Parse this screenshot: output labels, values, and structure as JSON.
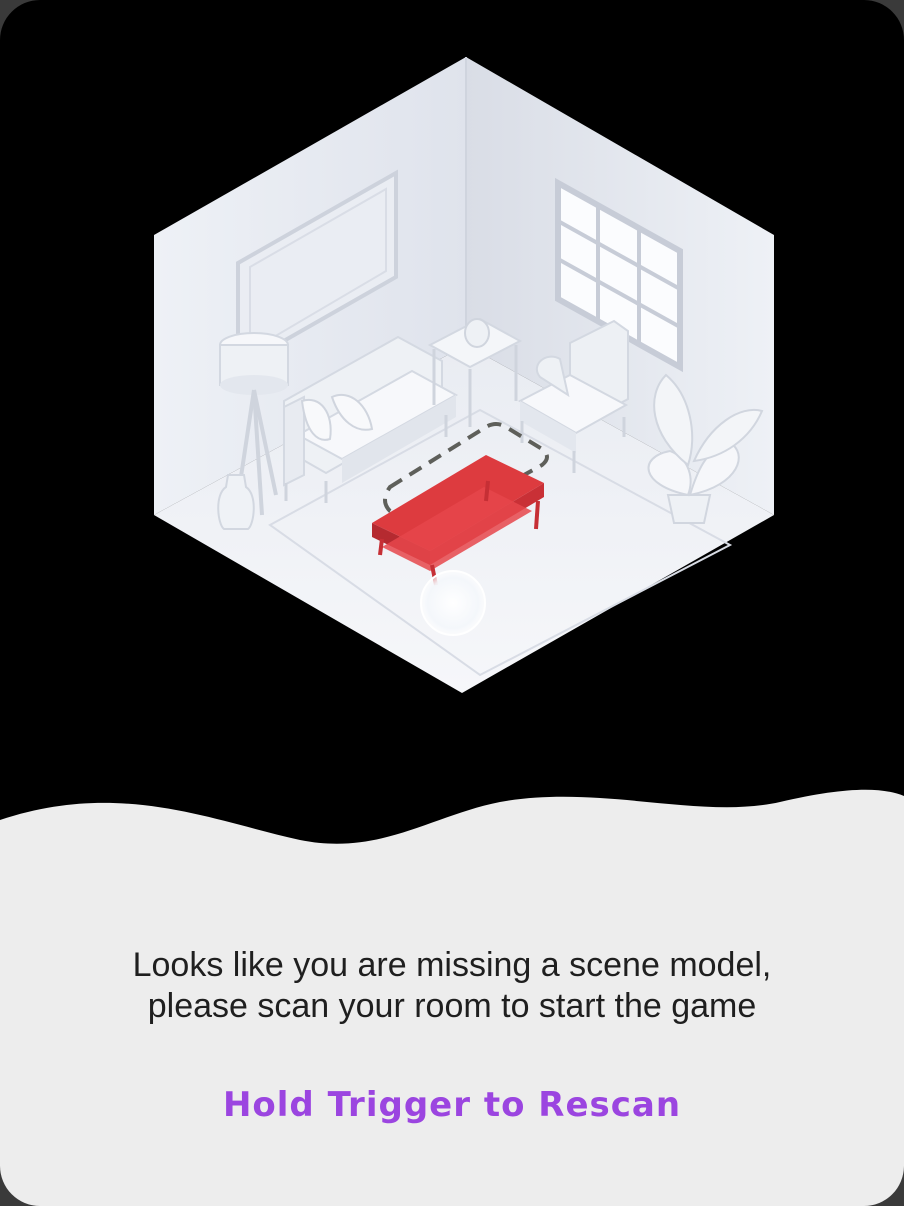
{
  "scene_prompt": {
    "message": "Looks like you are missing a scene model,\nplease scan your room to start the game",
    "action_label": "Hold Trigger to Rescan",
    "accent_color": "#9b45e0",
    "highlight_color": "#dd3b3f"
  },
  "icons": {
    "illustration": "room-scan-illustration",
    "cursor": "controller-pointer-icon"
  }
}
